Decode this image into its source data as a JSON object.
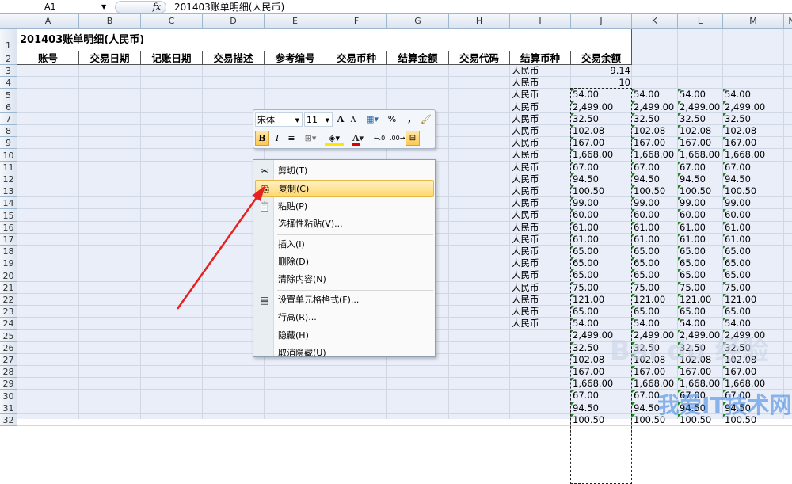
{
  "formula_bar": {
    "name_box": "A1",
    "fx": "fx",
    "formula": "201403账单明细(人民币)"
  },
  "columns": [
    "A",
    "B",
    "C",
    "D",
    "E",
    "F",
    "G",
    "H",
    "I",
    "J",
    "K",
    "L",
    "M",
    "N"
  ],
  "sheet": {
    "title": "201403账单明细(人民币)",
    "headers": [
      "账号",
      "交易日期",
      "记账日期",
      "交易描述",
      "参考编号",
      "交易币种",
      "结算金额",
      "交易代码",
      "结算币种",
      "交易余额"
    ],
    "currency": "人民币",
    "j3": "9.14",
    "j4": "10",
    "values": [
      "54.00",
      "2,499.00",
      "32.50",
      "102.08",
      "167.00",
      "1,668.00",
      "67.00",
      "94.50",
      "100.50",
      "99.00",
      "60.00",
      "61.00",
      "61.00",
      "65.00",
      "65.00",
      "65.00",
      "75.00",
      "121.00",
      "65.00",
      "54.00",
      "2,499.00",
      "32.50",
      "102.08",
      "167.00",
      "1,668.00",
      "67.00",
      "94.50",
      "100.50"
    ]
  },
  "mini_toolbar": {
    "font": "宋体",
    "size": "11",
    "grow": "A",
    "shrink": "A",
    "percent": "%",
    "comma": ",",
    "bold": "B",
    "italic": "I",
    "font_color": "A"
  },
  "context_menu": {
    "items": [
      {
        "label": "剪切(T)",
        "icon": "scissors-icon"
      },
      {
        "label": "复制(C)",
        "icon": "copy-icon",
        "highlighted": true
      },
      {
        "label": "粘贴(P)",
        "icon": "paste-icon"
      },
      {
        "label": "选择性粘贴(V)...",
        "icon": ""
      },
      {
        "label": "插入(I)",
        "icon": ""
      },
      {
        "label": "删除(D)",
        "icon": ""
      },
      {
        "label": "清除内容(N)",
        "icon": ""
      },
      {
        "label": "设置单元格格式(F)...",
        "icon": "format-cells-icon"
      },
      {
        "label": "行高(R)...",
        "icon": ""
      },
      {
        "label": "隐藏(H)",
        "icon": ""
      },
      {
        "label": "取消隐藏(U)",
        "icon": ""
      }
    ]
  },
  "watermark": {
    "text1": "Baidu经验",
    "text2": "我爱IT技术网"
  },
  "colors": {
    "arrow": "#e82020",
    "highlight": "#ffd76b",
    "grid_bg": "#e9eef8"
  }
}
